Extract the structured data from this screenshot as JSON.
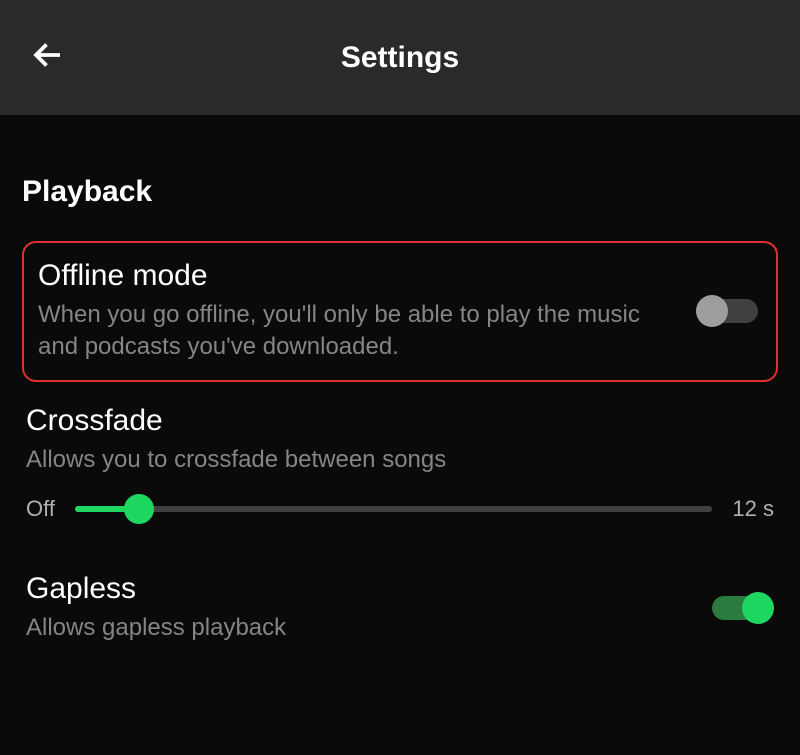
{
  "header": {
    "title": "Settings"
  },
  "section": {
    "title": "Playback"
  },
  "offline": {
    "title": "Offline mode",
    "desc": "When you go offline, you'll only be able to play the music and podcasts you've downloaded.",
    "enabled": false
  },
  "crossfade": {
    "title": "Crossfade",
    "desc": "Allows you to crossfade between songs",
    "min_label": "Off",
    "max_label": "12 s",
    "value_percent": 10
  },
  "gapless": {
    "title": "Gapless",
    "desc": "Allows gapless playback",
    "enabled": true
  },
  "colors": {
    "accent": "#1ed760",
    "highlight_border": "#e03030"
  }
}
